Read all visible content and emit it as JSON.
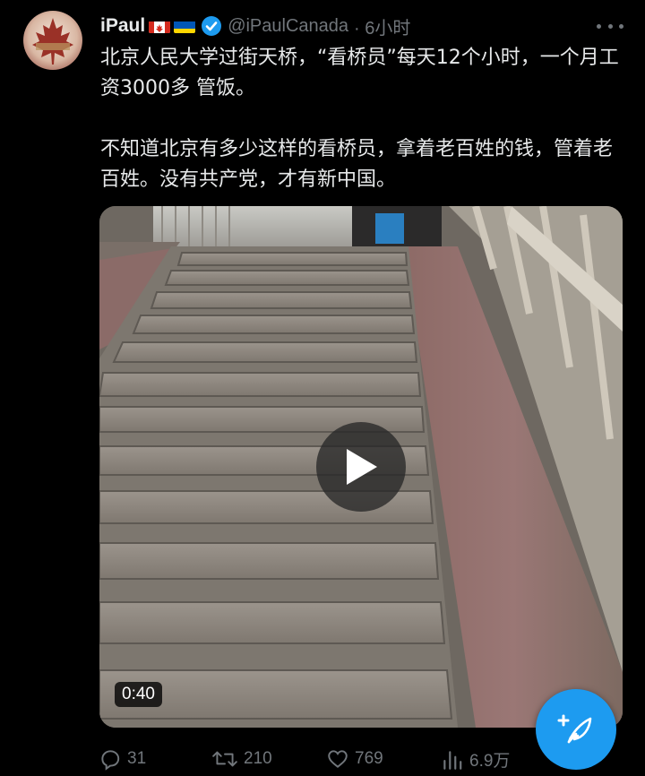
{
  "author": {
    "name": "iPaul",
    "handle": "@iPaulCanada",
    "time": "· 6小时"
  },
  "tweet": {
    "paragraphs": [
      "北京人民大学过街天桥，“看桥员”每天12个小时，一个月工资3000多 管饭。",
      "不知道北京有多少这样的看桥员，拿着老百姓的钱，管着老百姓。没有共产党，才有新中国。"
    ]
  },
  "media": {
    "duration": "0:40"
  },
  "actions": {
    "replies": "31",
    "retweets": "210",
    "likes": "769",
    "views": "6.9万"
  },
  "icons": {
    "verified": "verified-badge-icon",
    "more": "more-options-icon",
    "play": "play-icon",
    "reply": "reply-icon",
    "retweet": "retweet-icon",
    "like": "heart-icon",
    "views": "views-chart-icon",
    "compose": "compose-tweet-icon"
  },
  "colors": {
    "background": "#000000",
    "text": "#e7e9ea",
    "muted": "#71767b",
    "accent": "#1d9bf0"
  }
}
